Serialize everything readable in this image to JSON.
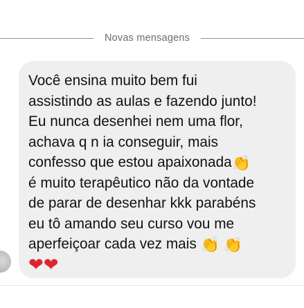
{
  "divider": {
    "label": "Novas mensagens"
  },
  "message": {
    "lines": [
      "Você ensina muito bem fui",
      "assistindo as aulas e fazendo junto!",
      "Eu nunca desenhei nem uma flor,",
      "achava q n ia conseguir, mais",
      "confesso que estou apaixonada",
      "é muito terapêutico não da vontade",
      "de parar de desenhar kkk parabéns",
      "eu tô amando seu curso vou me",
      "aperfeiçoar cada vez mais"
    ],
    "emoji": {
      "clap": "👏",
      "heart": "❤"
    }
  },
  "colors": {
    "bubble_background": "#efefef",
    "divider_text": "#6b6b6b",
    "message_text": "#111111",
    "heart": "#e0242e"
  },
  "icons": [
    "clapping-hands-icon",
    "red-heart-icon",
    "avatar"
  ]
}
